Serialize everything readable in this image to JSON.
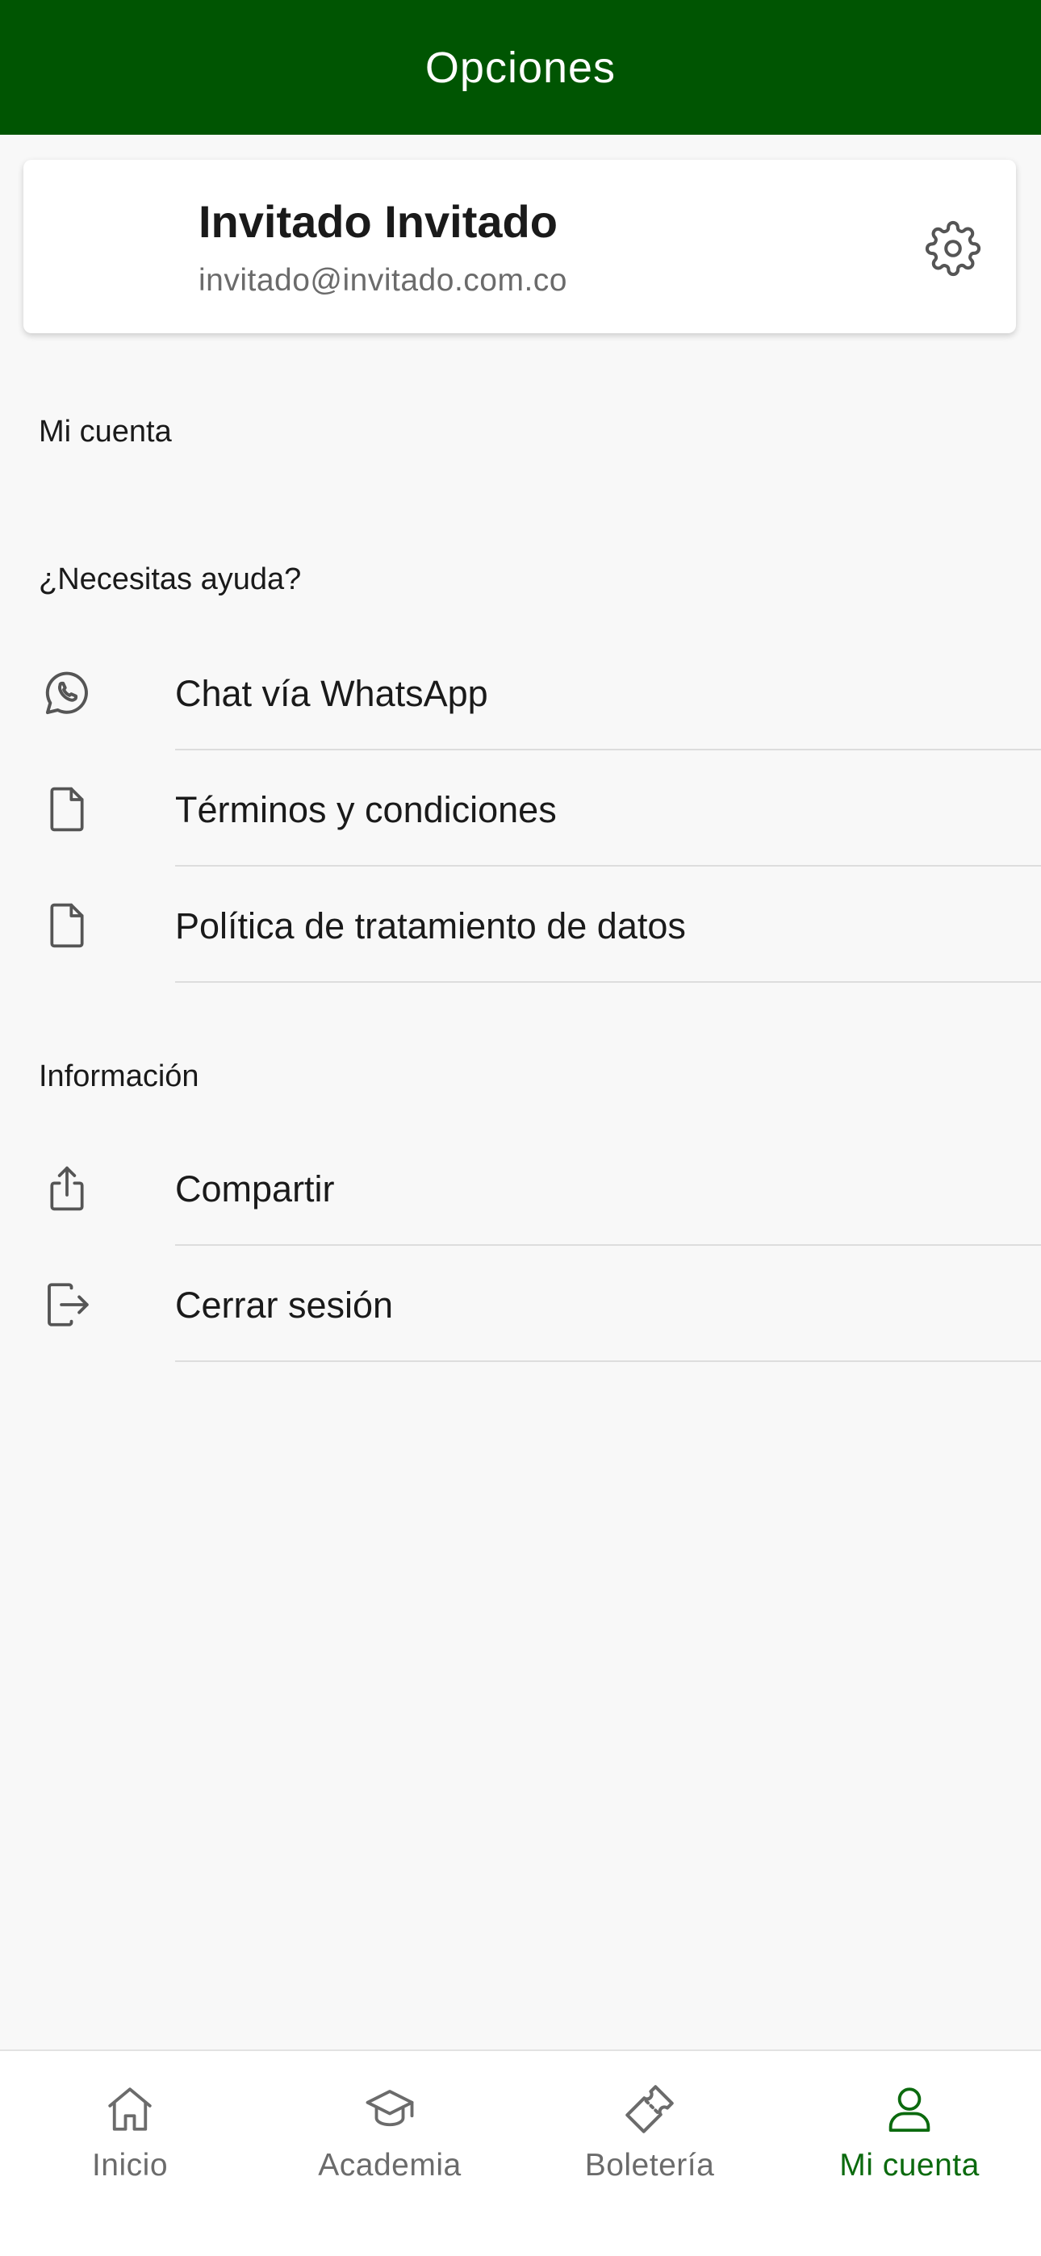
{
  "header": {
    "title": "Opciones"
  },
  "profile": {
    "name": "Invitado Invitado",
    "email": "invitado@invitado.com.co",
    "settings_icon": "gear-icon"
  },
  "sections": {
    "account": {
      "label": "Mi cuenta"
    },
    "help": {
      "label": "¿Necesitas ayuda?",
      "items": [
        {
          "label": "Chat vía WhatsApp",
          "icon": "whatsapp-icon"
        },
        {
          "label": "Términos y condiciones",
          "icon": "document-icon"
        },
        {
          "label": "Política de tratamiento de datos",
          "icon": "document-icon"
        }
      ]
    },
    "info": {
      "label": "Información",
      "items": [
        {
          "label": "Compartir",
          "icon": "share-icon"
        },
        {
          "label": "Cerrar sesión",
          "icon": "logout-icon"
        }
      ]
    }
  },
  "bottom_nav": {
    "items": [
      {
        "label": "Inicio",
        "icon": "home-icon",
        "active": false
      },
      {
        "label": "Academia",
        "icon": "graduation-cap-icon",
        "active": false
      },
      {
        "label": "Boletería",
        "icon": "ticket-icon",
        "active": false
      },
      {
        "label": "Mi cuenta",
        "icon": "user-icon",
        "active": true
      }
    ]
  },
  "colors": {
    "header_bg": "#005502",
    "active_nav": "#0b6a0e",
    "inactive_nav": "#6b6b6b",
    "background": "#f8f8f8"
  }
}
